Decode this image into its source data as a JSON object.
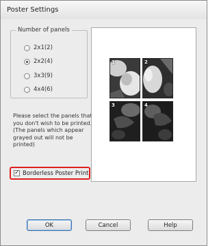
{
  "window": {
    "title": "Poster Settings"
  },
  "panels_group": {
    "label": "Number of panels",
    "options": [
      {
        "label": "2x1(2)",
        "selected": false
      },
      {
        "label": "2x2(4)",
        "selected": true
      },
      {
        "label": "3x3(9)",
        "selected": false
      },
      {
        "label": "4x4(6)",
        "selected": false
      }
    ]
  },
  "instructions": "Please select the panels that you don't wish to be printed. (The panels which appear grayed out will not be printed)",
  "borderless": {
    "label": "Borderless Poster Print",
    "checked": true,
    "check_glyph": "✓"
  },
  "preview": {
    "panel_numbers": [
      "1",
      "2",
      "3",
      "4"
    ]
  },
  "buttons": {
    "ok": "OK",
    "cancel": "Cancel",
    "help": "Help"
  },
  "colors": {
    "highlight_border": "#e02020",
    "dialog_bg": "#ececec"
  }
}
